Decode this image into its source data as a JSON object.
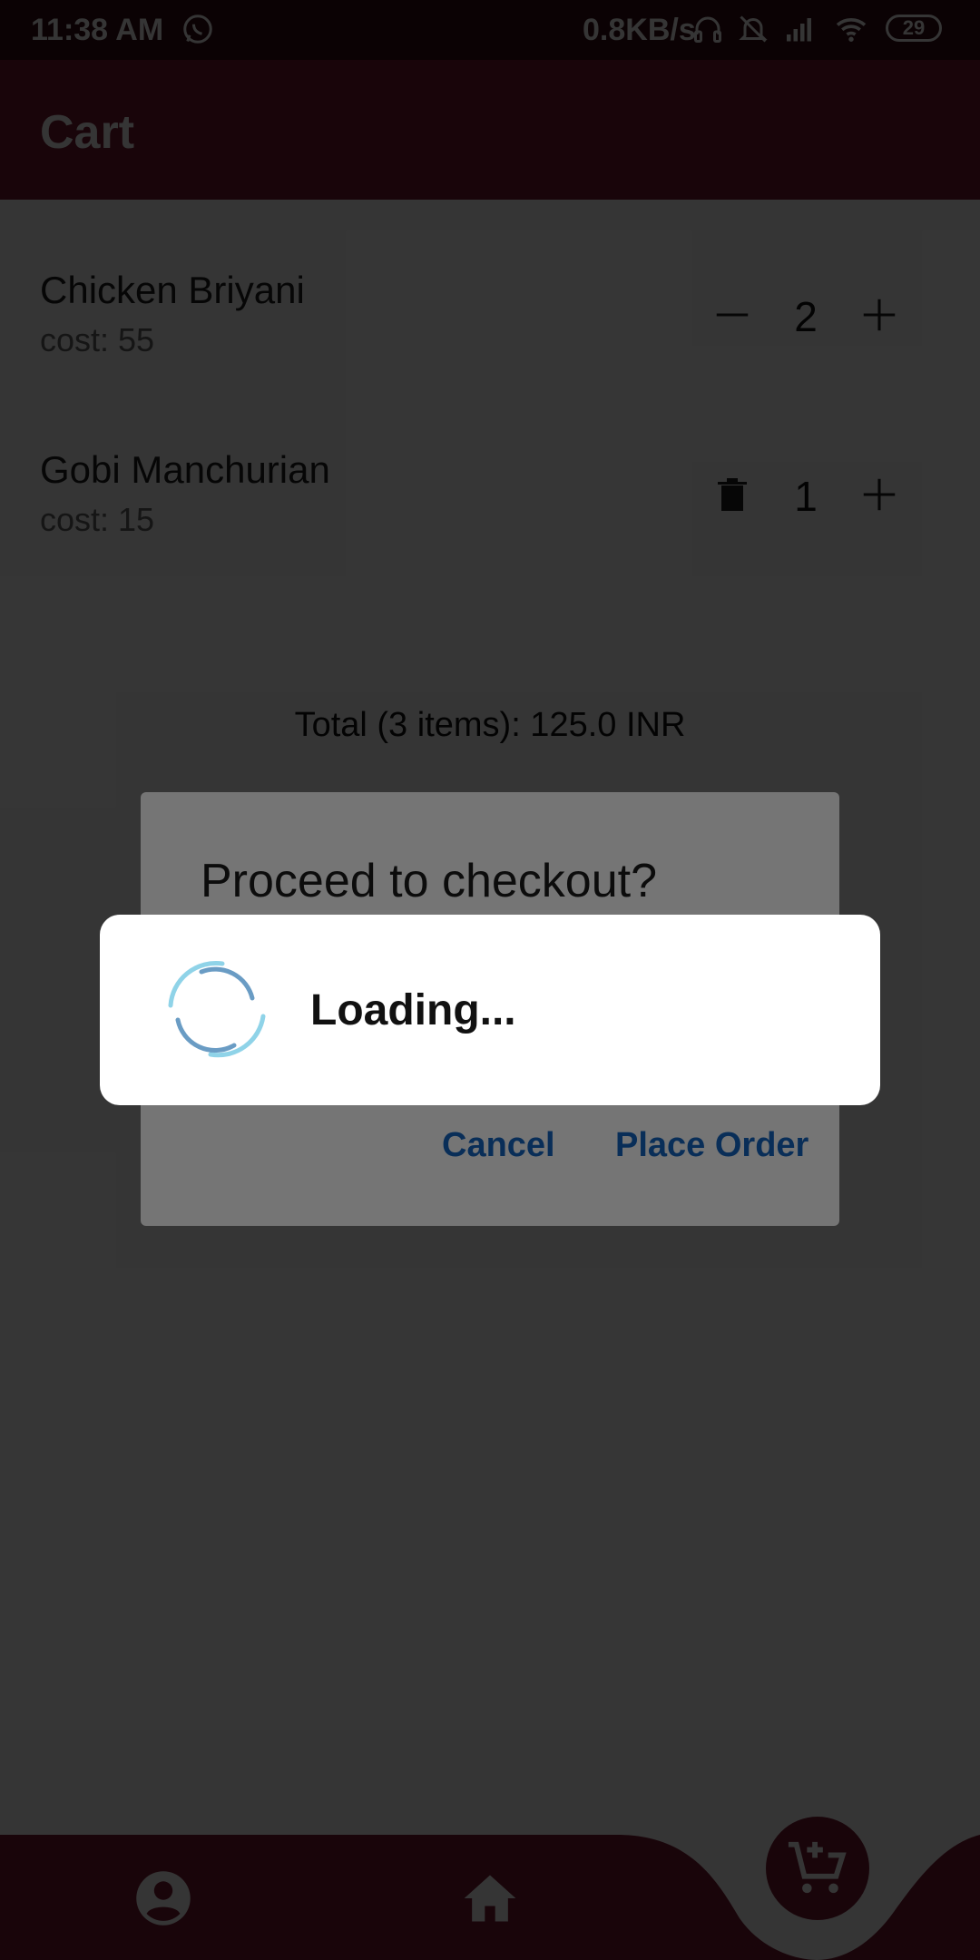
{
  "status_bar": {
    "time": "11:38 AM",
    "net_rate": "0.8KB/s",
    "battery": "29",
    "icons": [
      "whatsapp-icon",
      "headset-icon",
      "bell-off-icon",
      "signal-icon",
      "wifi-icon",
      "battery-icon"
    ]
  },
  "app_bar": {
    "title": "Cart"
  },
  "cart": {
    "items": [
      {
        "name": "Chicken Briyani",
        "cost": "cost: 55",
        "quantity": "2",
        "left_action": "minus-icon"
      },
      {
        "name": "Gobi Manchurian",
        "cost": "cost: 15",
        "quantity": "1",
        "left_action": "delete-icon"
      }
    ],
    "total": "Total (3 items): 125.0 INR"
  },
  "checkout_dialog": {
    "title": "Proceed to checkout?",
    "cancel": "Cancel",
    "place_order": "Place Order"
  },
  "loading_dialog": {
    "text": "Loading..."
  },
  "bottom_nav": {
    "items": [
      "profile-icon",
      "home-icon",
      "cart-add-icon"
    ],
    "active": "cart-add-icon"
  },
  "colors": {
    "primary": "#7a1a31",
    "status_bar": "#3a0d17",
    "dialog_button": "#1565c0",
    "spinner_light": "#8fd3e8",
    "spinner_dark": "#6a9cc4"
  }
}
